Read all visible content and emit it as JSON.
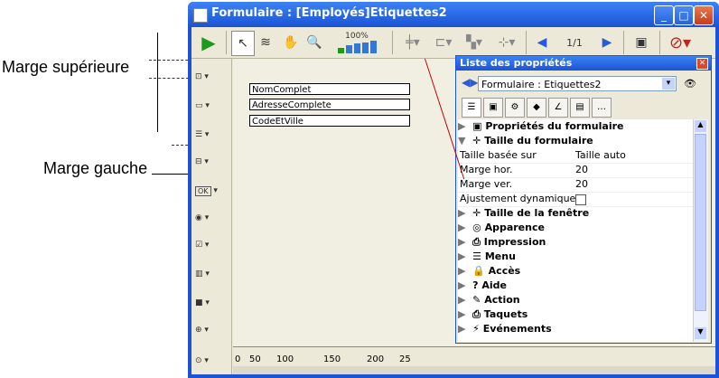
{
  "annotations": {
    "top_margin": "Marge supérieure",
    "left_margin": "Marge gauche"
  },
  "window": {
    "title": "Formulaire : [Employés]Etiquettes2",
    "controls": [
      "minimize-icon",
      "maximize-icon",
      "close-icon"
    ]
  },
  "toolbar": {
    "zoom_label": "100%",
    "page_indicator": "1/1",
    "icons": [
      "run-icon",
      "arrow-cursor-icon",
      "reorder-icon",
      "hand-icon",
      "zoom-icon",
      "zoom-level-icon",
      "align-icon",
      "distribute-icon",
      "arrange-icon",
      "group-icon",
      "prev-page-icon",
      "next-page-icon",
      "view-icon",
      "forbidden-icon"
    ]
  },
  "form": {
    "fields": [
      "NomComplet",
      "AdresseComplete",
      "CodeEtVille"
    ],
    "ruler_ticks": [
      "0",
      "50",
      "100",
      "150",
      "200",
      "25"
    ]
  },
  "left_palette": {
    "items": [
      "field-tool",
      "text-tool",
      "list-tool",
      "combo-tool",
      "ok-button-tool",
      "radio-tool",
      "checkbox-tool",
      "thermometer-tool",
      "rectangle-tool",
      "splitter-tool",
      "plugin-tool"
    ],
    "ok_label": "OK"
  },
  "properties": {
    "title": "Liste des propriétés",
    "object_selector": "Formulaire : Etiquettes2",
    "rows": [
      {
        "kind": "section",
        "label": "Propriétés du formulaire",
        "expanded": false
      },
      {
        "kind": "section",
        "label": "Taille du formulaire",
        "expanded": true
      },
      {
        "kind": "property",
        "label": "Taille basée sur",
        "value": "Taille auto"
      },
      {
        "kind": "property",
        "label": "Marge hor.",
        "value": "20"
      },
      {
        "kind": "property",
        "label": "Marge ver.",
        "value": "20"
      },
      {
        "kind": "checkbox",
        "label": "Ajustement dynamique",
        "value": ""
      },
      {
        "kind": "section",
        "label": "Taille de la fenêtre",
        "expanded": false
      },
      {
        "kind": "section",
        "label": "Apparence",
        "expanded": false
      },
      {
        "kind": "section",
        "label": "Impression",
        "expanded": false
      },
      {
        "kind": "section",
        "label": "Menu",
        "expanded": false
      },
      {
        "kind": "section",
        "label": "Accès",
        "expanded": false
      },
      {
        "kind": "section",
        "label": "Aide",
        "expanded": false
      },
      {
        "kind": "section",
        "label": "Action",
        "expanded": false
      },
      {
        "kind": "section",
        "label": "Taquets",
        "expanded": false
      },
      {
        "kind": "section",
        "label": "Evénements",
        "expanded": false
      }
    ],
    "tab_icons": [
      "list-view-icon",
      "object-icon",
      "settings-icon",
      "shapes-icon",
      "chart-icon",
      "window-icon",
      "more-icon"
    ]
  },
  "colors": {
    "window_blue": "#1e52d6",
    "chrome": "#ece9d8",
    "canvas": "#f1efe2"
  }
}
